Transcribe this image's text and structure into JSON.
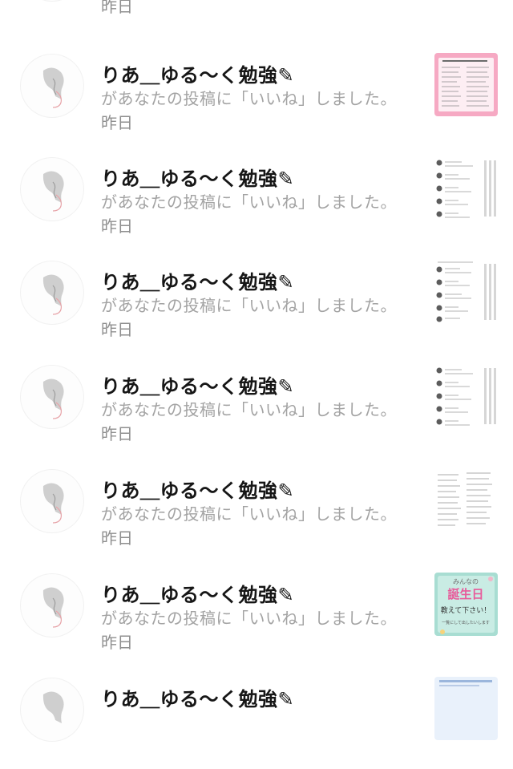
{
  "notifications": [
    {
      "username": "",
      "message": "",
      "time": "昨日",
      "thumbnail": "colorful-post-thumbnail",
      "partial": "top"
    },
    {
      "username": "りあ＿ゆる〜く勉強✎",
      "message": "があなたの投稿に「いいね」しました。",
      "time": "昨日",
      "thumbnail": "pink-list-thumbnail"
    },
    {
      "username": "りあ＿ゆる〜く勉強✎",
      "message": "があなたの投稿に「いいね」しました。",
      "time": "昨日",
      "thumbnail": "comment-list-thumbnail"
    },
    {
      "username": "りあ＿ゆる〜く勉強✎",
      "message": "があなたの投稿に「いいね」しました。",
      "time": "昨日",
      "thumbnail": "comment-list-thumbnail"
    },
    {
      "username": "りあ＿ゆる〜く勉強✎",
      "message": "があなたの投稿に「いいね」しました。",
      "time": "昨日",
      "thumbnail": "comment-list-thumbnail"
    },
    {
      "username": "りあ＿ゆる〜く勉強✎",
      "message": "があなたの投稿に「いいね」しました。",
      "time": "昨日",
      "thumbnail": "handwritten-notes-thumbnail"
    },
    {
      "username": "りあ＿ゆる〜く勉強✎",
      "message": "があなたの投稿に「いいね」しました。",
      "time": "昨日",
      "thumbnail": "birthday-post-thumbnail",
      "thumbnail_text": {
        "line1": "みんなの",
        "line2": "誕生日",
        "line3": "教えて下さい！",
        "line4": "一覧にして出したいします"
      }
    },
    {
      "username": "りあ＿ゆる〜く勉強✎",
      "message": "",
      "time": "",
      "thumbnail": "colorful-post-thumbnail",
      "partial": "bottom"
    }
  ],
  "colors": {
    "username": "#161616",
    "message": "#a3a3a3",
    "time": "#8f8f8f",
    "pink_thumb": "#f6a9c3",
    "birthday_thumb": "#a8ddd2",
    "accent_pink": "#e85a9a"
  }
}
